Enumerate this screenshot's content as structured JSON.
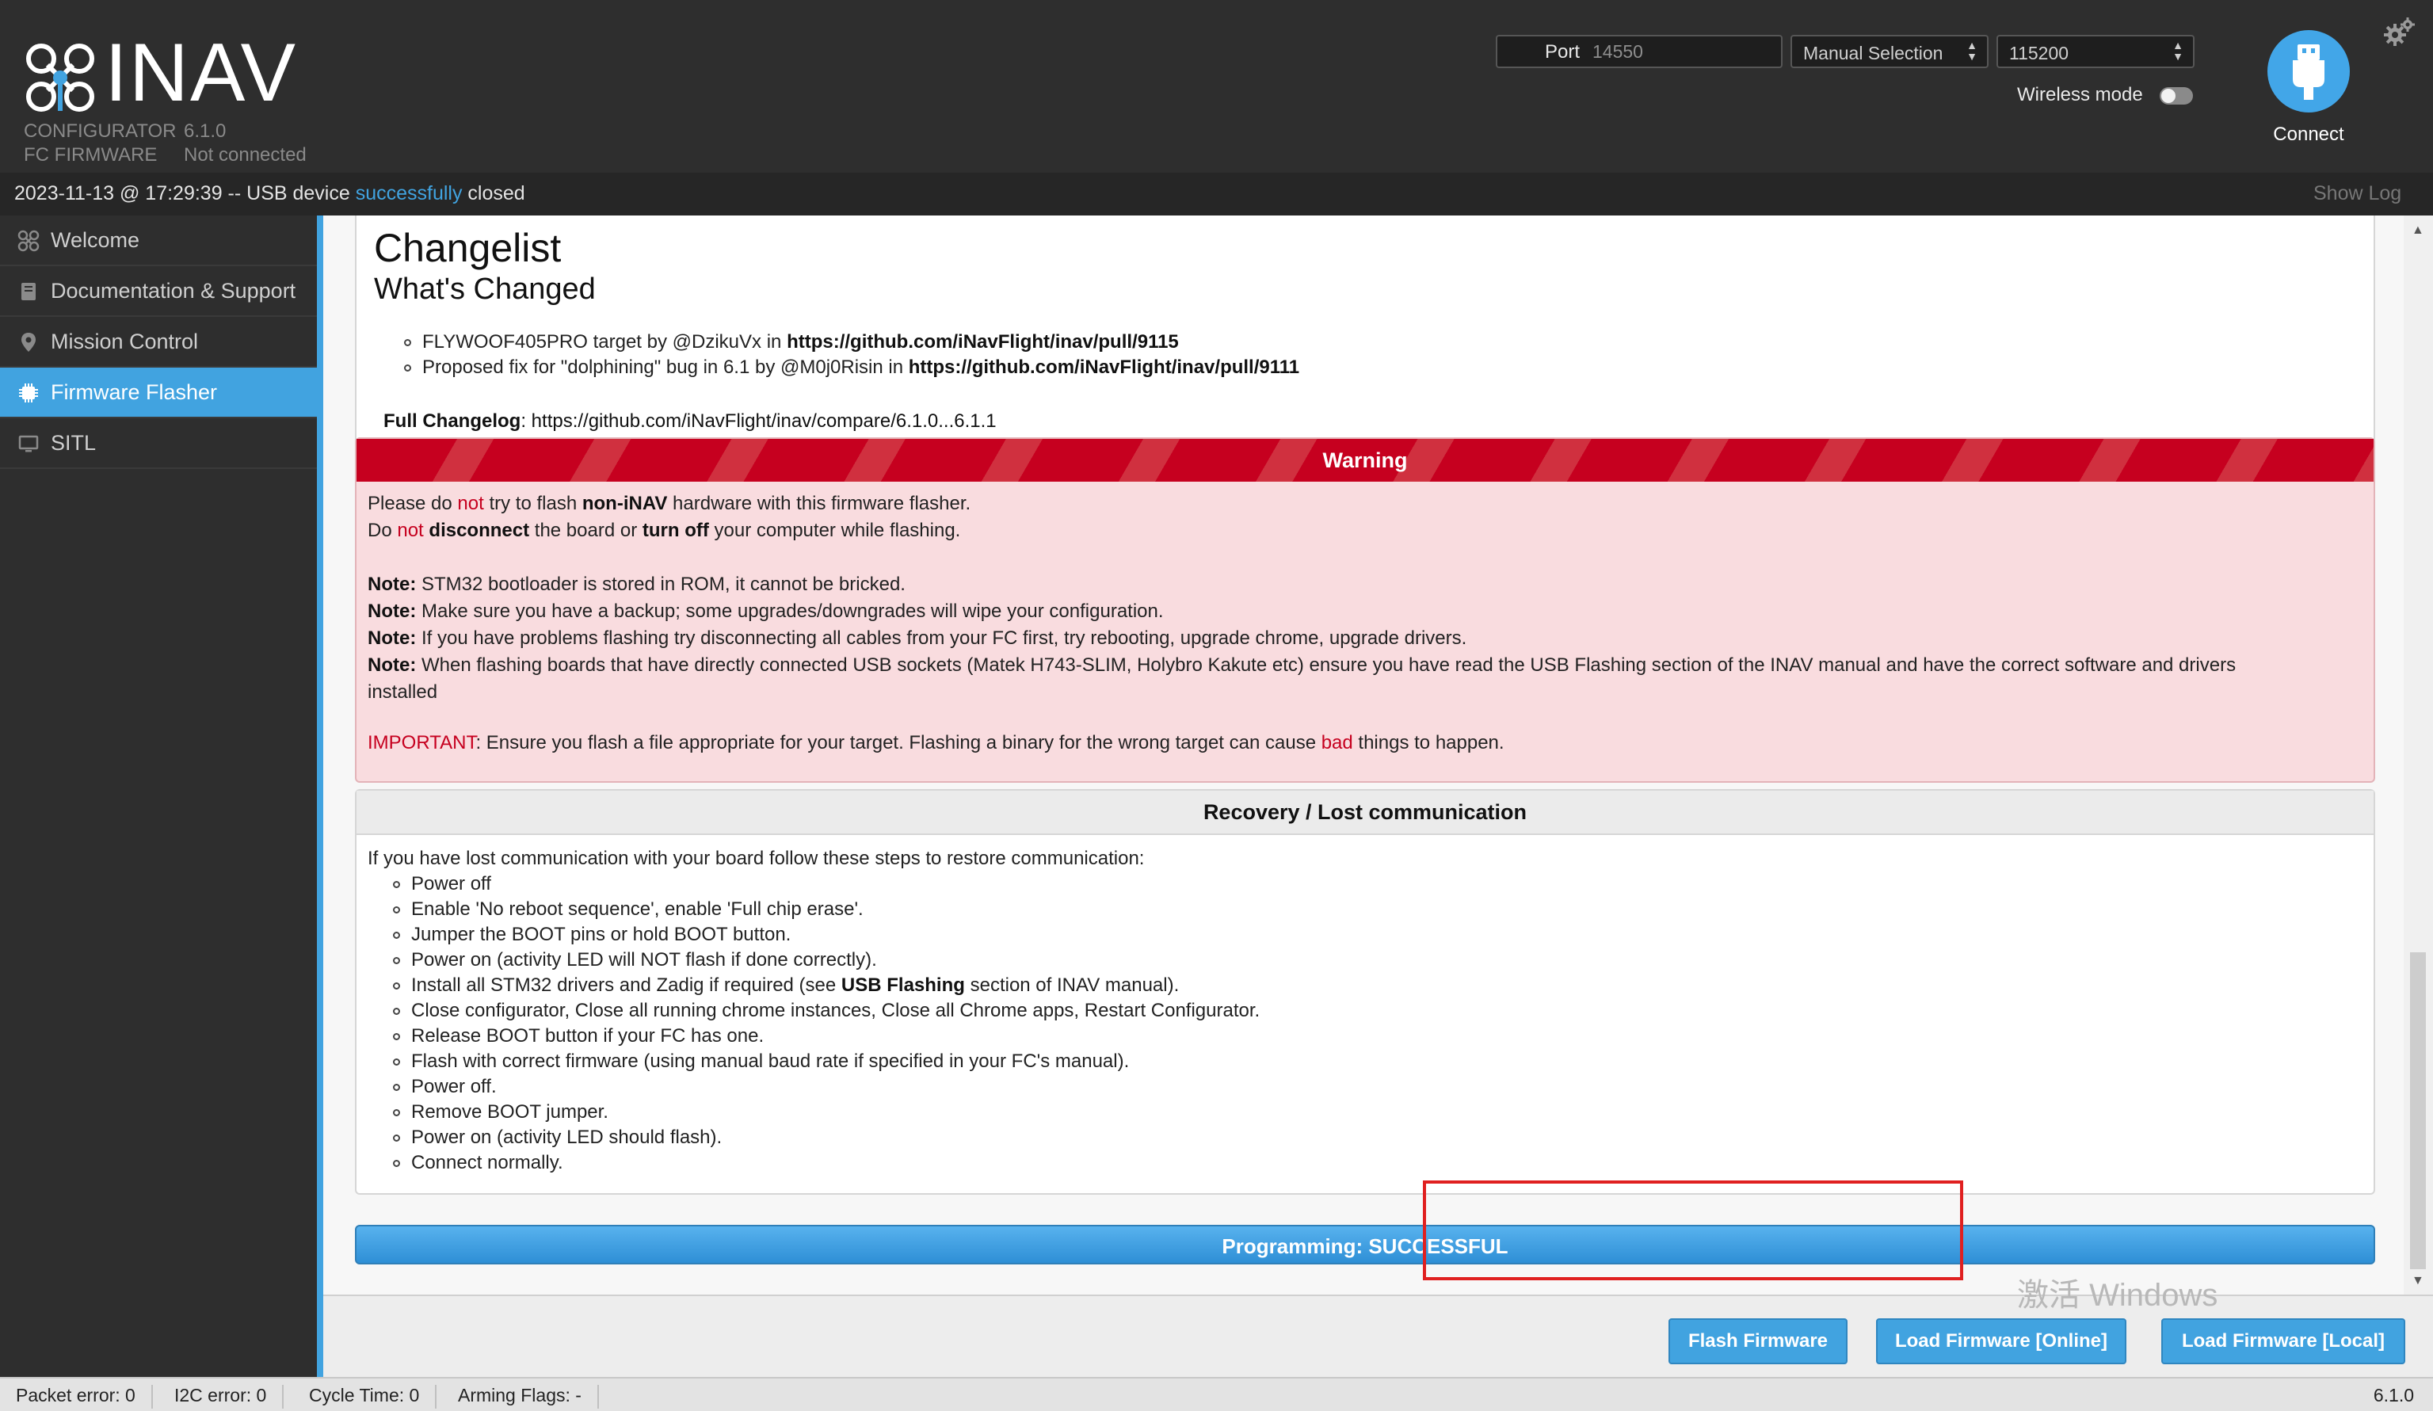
{
  "header": {
    "logo_text": "INAV",
    "configurator_label": "CONFIGURATOR",
    "configurator_version": "6.1.0",
    "firmware_label": "FC FIRMWARE",
    "firmware_status": "Not connected",
    "port_label": "Port",
    "port_value": "14550",
    "port_mode": "Manual Selection",
    "baud_rate": "115200",
    "wireless_label": "Wireless mode",
    "wireless_on": false,
    "connect_label": "Connect"
  },
  "log": {
    "prefix": "2023-11-13 @ 17:29:39 -- USB device ",
    "highlight": "successfully",
    "suffix": " closed",
    "show_log": "Show Log"
  },
  "sidebar": {
    "items": [
      {
        "label": "Welcome",
        "icon": "drone-icon"
      },
      {
        "label": "Documentation & Support",
        "icon": "book-icon"
      },
      {
        "label": "Mission Control",
        "icon": "map-pin-icon"
      },
      {
        "label": "Firmware Flasher",
        "icon": "chip-icon",
        "active": true
      },
      {
        "label": "SITL",
        "icon": "monitor-icon"
      }
    ]
  },
  "changelog": {
    "title": "Changelist",
    "subtitle": "What's Changed",
    "items": [
      {
        "text": "FLYWOOF405PRO target by @DzikuVx in ",
        "link": "https://github.com/iNavFlight/inav/pull/9115"
      },
      {
        "text": "Proposed fix for \"dolphining\" bug in 6.1 by @M0j0Risin in ",
        "link": "https://github.com/iNavFlight/inav/pull/9111"
      }
    ],
    "full_label": "Full Changelog",
    "full_link": "https://github.com/iNavFlight/inav/compare/6.1.0...6.1.1"
  },
  "warning": {
    "title": "Warning",
    "l1a": "Please do ",
    "l1b": "not",
    "l1c": " try to flash ",
    "l1d": "non-iNAV",
    "l1e": " hardware with this firmware flasher.",
    "l2a": "Do ",
    "l2b": "not",
    "l2c": " ",
    "l2d": "disconnect",
    "l2e": " the board or ",
    "l2f": "turn off",
    "l2g": " your computer while flashing.",
    "note_label": "Note:",
    "n1": " STM32 bootloader is stored in ROM, it cannot be bricked.",
    "n2": " Make sure you have a backup; some upgrades/downgrades will wipe your configuration.",
    "n3": " If you have problems flashing try disconnecting all cables from your FC first, try rebooting, upgrade chrome, upgrade drivers.",
    "n4a": " When flashing boards that have directly connected USB sockets (Matek H743-SLIM, Holybro Kakute etc) ensure you have read the USB Flashing section of the INAV manual and have the correct software and drivers",
    "n4b": "installed",
    "imp_label": "IMPORTANT",
    "imp_a": ": Ensure you flash a file appropriate for your target. Flashing a binary for the wrong target can cause ",
    "imp_b": "bad",
    "imp_c": " things to happen."
  },
  "recovery": {
    "title": "Recovery / Lost communication",
    "intro": "If you have lost communication with your board follow these steps to restore communication:",
    "s1": "Power off",
    "s2": "Enable 'No reboot sequence', enable 'Full chip erase'.",
    "s3": "Jumper the BOOT pins or hold BOOT button.",
    "s4": "Power on (activity LED will NOT flash if done correctly).",
    "s5a": "Install all STM32 drivers and Zadig if required (see ",
    "s5b": "USB Flashing",
    "s5c": " section of INAV manual).",
    "s6": "Close configurator, Close all running chrome instances, Close all Chrome apps, Restart Configurator.",
    "s7": "Release BOOT button if your FC has one.",
    "s8": "Flash with correct firmware (using manual baud rate if specified in your FC's manual).",
    "s9": "Power off.",
    "s10": "Remove BOOT jumper.",
    "s11": "Power on (activity LED should flash).",
    "s12": "Connect normally."
  },
  "progress": {
    "text": "Programming: SUCCESSFUL",
    "value": 1.0
  },
  "toolbar": {
    "flash": "Flash Firmware",
    "load_online": "Load Firmware [Online]",
    "load_local": "Load Firmware [Local]"
  },
  "watermark": {
    "line1": "激活 Windows"
  },
  "status": {
    "packet_error": "Packet error: 0",
    "i2c_error": "I2C error: 0",
    "cycle_time": "Cycle Time: 0",
    "arming_flags": "Arming Flags: -",
    "version": "6.1.0"
  },
  "colors": {
    "accent": "#41a3e0",
    "warning_red": "#c6001f",
    "highlight_box": "#e02020"
  }
}
